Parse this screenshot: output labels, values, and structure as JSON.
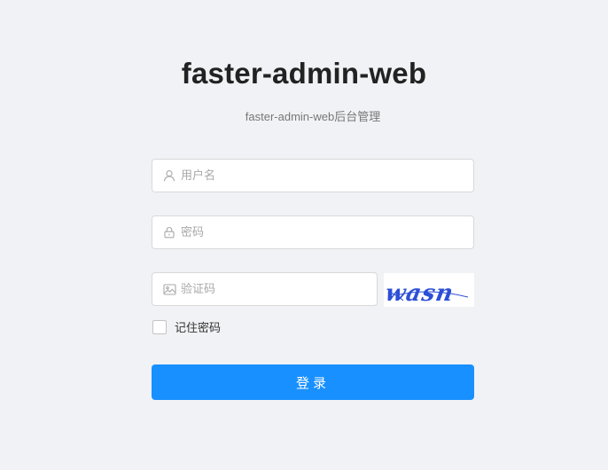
{
  "header": {
    "title": "faster-admin-web",
    "subtitle": "faster-admin-web后台管理"
  },
  "form": {
    "username": {
      "placeholder": "用户名",
      "value": "",
      "icon": "user-icon"
    },
    "password": {
      "placeholder": "密码",
      "value": "",
      "icon": "lock-icon"
    },
    "captcha": {
      "placeholder": "验证码",
      "value": "",
      "icon": "image-icon",
      "image_text": "wasn"
    },
    "remember_label": "记住密码",
    "remember_checked": false,
    "submit_label": "登录"
  },
  "colors": {
    "background": "#f0f2f5",
    "primary": "#1890ff",
    "captcha_text": "#2c4fd6"
  }
}
